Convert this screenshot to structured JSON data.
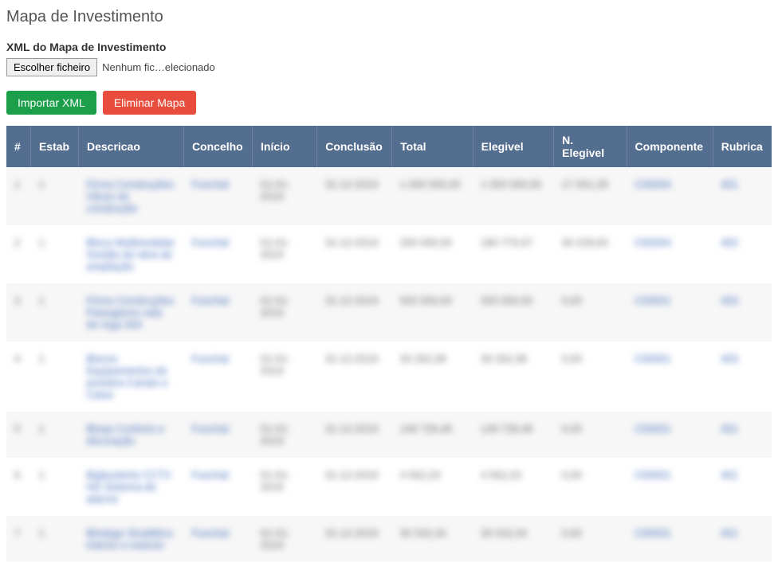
{
  "page": {
    "title": "Mapa de Investimento",
    "xml_label": "XML do Mapa de Investimento",
    "file_button": "Escolher ficheiro",
    "file_status": "Nenhum fic…elecionado",
    "import_button": "Importar XML",
    "delete_button": "Eliminar Mapa"
  },
  "table": {
    "headers": {
      "num": "#",
      "estab": "Estab",
      "descricao": "Descricao",
      "concelho": "Concelho",
      "inicio": "Início",
      "conclusao": "Conclusão",
      "total": "Total",
      "elegivel": "Elegivel",
      "nelegivel": "N. Elegivel",
      "componente": "Componente",
      "rubrica": "Rubrica"
    },
    "rows": [
      {
        "num": "1",
        "estab": "1",
        "descricao": "Firma Construções Obras de construção",
        "concelho": "Funchal",
        "inicio": "01-01-2019",
        "conclusao": "31-12-2019",
        "total": "1 000 000,00",
        "elegivel": "1 000 000,00",
        "nelegivel": "17 001,28",
        "componente": "C00004",
        "rubrica": "401"
      },
      {
        "num": "2",
        "estab": "1",
        "descricao": "Bloco Multimodelar Gestão de obra de ampliação",
        "concelho": "Funchal",
        "inicio": "01-01-2019",
        "conclusao": "31-12-2019",
        "total": "200 000,00",
        "elegivel": "180 770,07",
        "nelegivel": "30 229,93",
        "componente": "C00004",
        "rubrica": "402"
      },
      {
        "num": "3",
        "estab": "1",
        "descricao": "Firma Construções Paisagismo vala de rega 304",
        "concelho": "Funchal",
        "inicio": "01-01-2019",
        "conclusao": "31-12-2019",
        "total": "500 000,00",
        "elegivel": "500 000,00",
        "nelegivel": "0,00",
        "componente": "C00001",
        "rubrica": "403"
      },
      {
        "num": "4",
        "estab": "1",
        "descricao": "Blocos Equipamentos de ponteira Canais e Caixa",
        "concelho": "Funchal",
        "inicio": "01-01-2019",
        "conclusao": "31-12-2019",
        "total": "30 262,38",
        "elegivel": "30 262,38",
        "nelegivel": "0,00",
        "componente": "C00001",
        "rubrica": "403"
      },
      {
        "num": "5",
        "estab": "1",
        "descricao": "Bloqa Conforto e decoração",
        "concelho": "Funchal",
        "inicio": "01-01-2019",
        "conclusao": "31-12-2019",
        "total": "148 728,48",
        "elegivel": "148 728,48",
        "nelegivel": "0,00",
        "componente": "C00001",
        "rubrica": "401"
      },
      {
        "num": "6",
        "estab": "1",
        "descricao": "Bigbustenis CCTV HD Sistema de alarme",
        "concelho": "Funchal",
        "inicio": "01-01-2019",
        "conclusao": "31-12-2019",
        "total": "4 562,23",
        "elegivel": "4 562,23",
        "nelegivel": "0,00",
        "componente": "C00001",
        "rubrica": "401"
      },
      {
        "num": "7",
        "estab": "1",
        "descricao": "Blodago Sinalética interior e exterior",
        "concelho": "Funchal",
        "inicio": "01-01-2019",
        "conclusao": "31-12-2019",
        "total": "30 542,34",
        "elegivel": "30 542,34",
        "nelegivel": "0,00",
        "componente": "C00001",
        "rubrica": "401"
      }
    ]
  }
}
